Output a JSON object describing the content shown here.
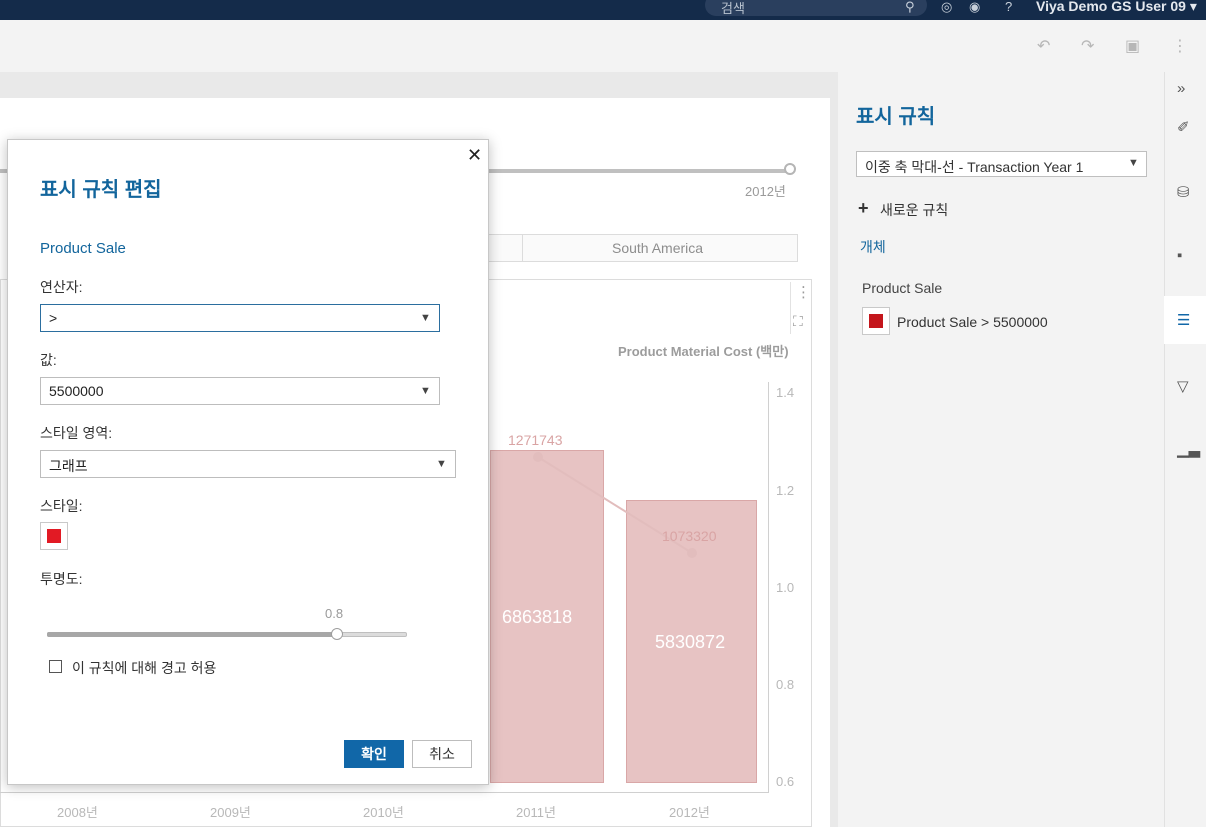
{
  "topbar": {
    "search_placeholder": "검색",
    "user_name": "Viya Demo GS User 09"
  },
  "report": {
    "slider_value_label": "2012년",
    "tabs": [
      "South America"
    ],
    "chart_menu_icons": [
      "more-vert-icon",
      "maximize-icon"
    ]
  },
  "chart_data": {
    "type": "bar",
    "categories": [
      "2008년",
      "2009년",
      "2010년",
      "2011년",
      "2012년"
    ],
    "series": [
      {
        "type": "bar",
        "values": [
          null,
          null,
          null,
          6863818,
          5830872
        ]
      },
      {
        "type": "line",
        "values": [
          null,
          null,
          null,
          1271743,
          1073320
        ]
      }
    ],
    "y2label": "Product Material Cost (백만)",
    "y2_ticks": [
      "1.4",
      "1.2",
      "1.0",
      "0.8",
      "0.6"
    ],
    "y2lim": [
      0.6,
      1.4
    ],
    "bar_color": "#e7c3c3",
    "line_color": "#e2bdbd",
    "bar_labels": [
      "6863818",
      "5830872"
    ],
    "line_labels": [
      "1271743",
      "1073320"
    ]
  },
  "right_pane": {
    "title": "표시 규칙",
    "select_value": "이중 축 막대-선 - Transaction Year 1",
    "new_rule": "새로운 규칙",
    "object_label": "개체",
    "section": "Product Sale",
    "rule_text": "Product Sale > 5500000",
    "rule_color": "#c4161c"
  },
  "rail": {
    "icons": [
      "collapse-icon",
      "brush-icon",
      "data-icon",
      "object-icon",
      "rules-icon",
      "filter-icon",
      "chart-icon"
    ]
  },
  "modal": {
    "title": "표시 규칙 편집",
    "subtitle": "Product Sale",
    "operator_label": "연산자:",
    "operator_value": ">",
    "value_label": "값:",
    "value_value": "5500000",
    "style_area_label": "스타일 영역:",
    "style_area_value": "그래프",
    "style_label": "스타일:",
    "style_color": "#e21a24",
    "opacity_label": "투명도:",
    "opacity_value": "0.8",
    "opacity_fraction": 0.8,
    "warn_label": "이 규칙에 대해 경고 허용",
    "ok_label": "확인",
    "cancel_label": "취소"
  }
}
